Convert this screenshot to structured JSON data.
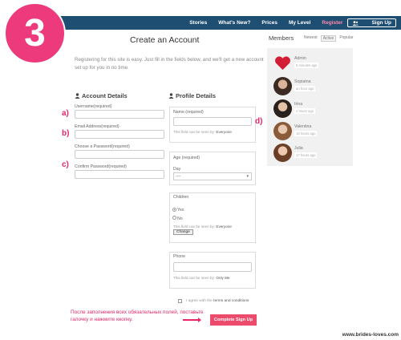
{
  "step_badge": "3",
  "nav": {
    "items": [
      "Stories",
      "What's New?",
      "Prices",
      "My Level",
      "Register"
    ],
    "signup": "Sign Up"
  },
  "page": {
    "title": "Create an Account",
    "intro": "Registering for this site is easy. Just fill in the fields below, and we'll get a new account set up for you in no time."
  },
  "account": {
    "heading": "Account Details",
    "username_label": "Username(required)",
    "email_label": "Email Address(required)",
    "password_label": "Choose a Password(required)",
    "confirm_label": "Confirm Password(required)"
  },
  "profile": {
    "heading": "Profile Details",
    "name_label": "Name (required)",
    "name_note_prefix": "This field can be seen by:",
    "name_note_value": "Everyone",
    "age_label": "Age (required)",
    "day_label": "Day",
    "day_value": "----",
    "children_label": "Children",
    "children_yes": "Yes",
    "children_no": "No",
    "children_note_prefix": "This field can be seen by:",
    "children_note_value": "Everyone",
    "change_label": "Change",
    "phone_label": "Phone",
    "phone_note_prefix": "This field can be seen by:",
    "phone_note_value": "Only Me"
  },
  "terms": {
    "prefix": "I agree with the",
    "link": "terms and conditions"
  },
  "submit_label": "Complete Sign Up",
  "instruction_ru": "После заполнения всех обязательных полей, поставьте галочку и нажмите кнопку.",
  "step_labels": {
    "a": "a)",
    "b": "b)",
    "c": "c)",
    "d": "d)"
  },
  "members": {
    "title": "Members",
    "tabs": [
      "Newest",
      "Active",
      "Popular"
    ],
    "active_tab": "Active",
    "list": [
      {
        "name": "Admin",
        "time": "5 minutes ago"
      },
      {
        "name": "Sopiatna",
        "time": "an hour ago"
      },
      {
        "name": "Irina",
        "time": "2 hours ago"
      },
      {
        "name": "Valentina",
        "time": "16 hours ago"
      },
      {
        "name": "Julia",
        "time": "17 hours ago"
      }
    ]
  },
  "colors": {
    "accent": "#ec3a7c",
    "nav": "#1f4e73",
    "button": "#ec4b6c"
  },
  "watermark": "www.brides-loves.com"
}
